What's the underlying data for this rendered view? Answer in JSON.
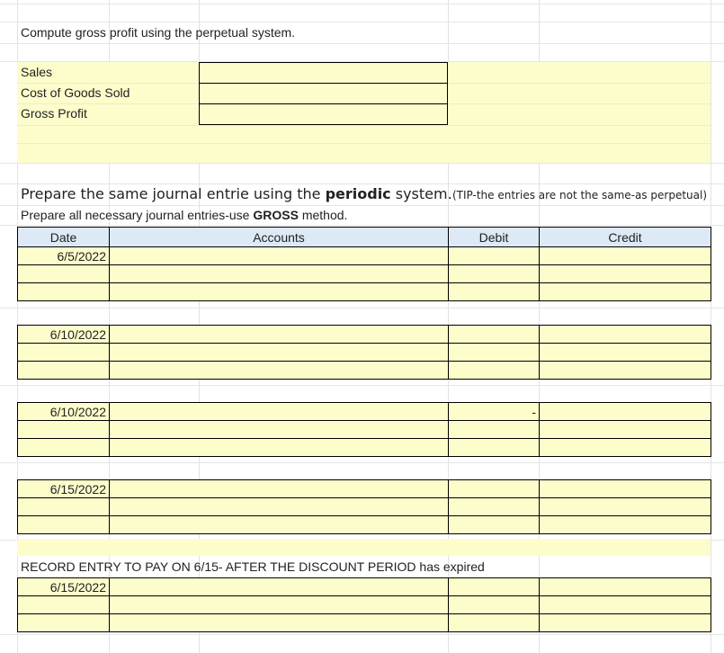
{
  "prompt1": "Compute gross profit using the perpetual system.",
  "gross_profit": {
    "rows": [
      {
        "label": "Sales",
        "value": ""
      },
      {
        "label": "Cost of Goods Sold",
        "value": ""
      },
      {
        "label": "Gross Profit",
        "value": ""
      }
    ]
  },
  "heading2": {
    "before": "Prepare the same journal entrie using the ",
    "bold": "periodic",
    "after": " system."
  },
  "tip": "(TIP-the entries are not the same-as perpetual)",
  "instruction": {
    "before": "Prepare all necessary journal entries-use ",
    "bold": "GROSS",
    "after": " method."
  },
  "journal": {
    "headers": [
      "Date",
      "Accounts",
      "Debit",
      "Credit"
    ],
    "entries": [
      {
        "date": "6/5/2022",
        "debit_mark": ""
      },
      {
        "date": "6/10/2022",
        "debit_mark": ""
      },
      {
        "date": "6/10/2022",
        "debit_mark": "-"
      },
      {
        "date": "6/15/2022",
        "debit_mark": ""
      }
    ]
  },
  "record_note": "RECORD ENTRY TO PAY ON 6/15- AFTER THE DISCOUNT PERIOD has expired",
  "final_entry": {
    "date": "6/15/2022"
  }
}
